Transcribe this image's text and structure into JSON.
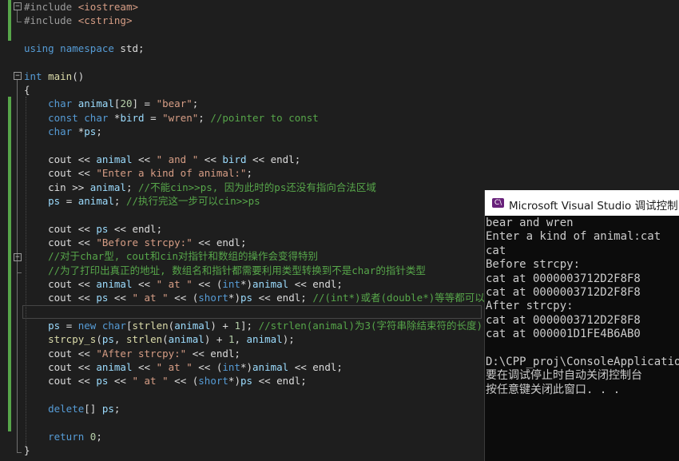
{
  "editor": {
    "lines": [
      [
        [
          "pp",
          "#include "
        ],
        [
          "str",
          "<iostream>"
        ]
      ],
      [
        [
          "pp",
          "#include "
        ],
        [
          "str",
          "<cstring>"
        ]
      ],
      [],
      [
        [
          "kw",
          "using"
        ],
        [
          "pl",
          " "
        ],
        [
          "kw",
          "namespace"
        ],
        [
          "pl",
          " std;"
        ]
      ],
      [],
      [
        [
          "kw",
          "int"
        ],
        [
          "pl",
          " "
        ],
        [
          "fn",
          "main"
        ],
        [
          "pl",
          "()"
        ]
      ],
      [
        [
          "pl",
          "{"
        ]
      ],
      [
        [
          "pl",
          "    "
        ],
        [
          "kw",
          "char"
        ],
        [
          "pl",
          " "
        ],
        [
          "var",
          "animal"
        ],
        [
          "pl",
          "["
        ],
        [
          "num",
          "20"
        ],
        [
          "pl",
          "] = "
        ],
        [
          "str",
          "\"bear\""
        ],
        [
          "pl",
          ";"
        ]
      ],
      [
        [
          "pl",
          "    "
        ],
        [
          "kw",
          "const"
        ],
        [
          "pl",
          " "
        ],
        [
          "kw",
          "char"
        ],
        [
          "pl",
          " *"
        ],
        [
          "var",
          "bird"
        ],
        [
          "pl",
          " = "
        ],
        [
          "str",
          "\"wren\""
        ],
        [
          "pl",
          "; "
        ],
        [
          "cmt",
          "//pointer to const"
        ]
      ],
      [
        [
          "pl",
          "    "
        ],
        [
          "kw",
          "char"
        ],
        [
          "pl",
          " *"
        ],
        [
          "var",
          "ps"
        ],
        [
          "pl",
          ";"
        ]
      ],
      [],
      [
        [
          "pl",
          "    cout << "
        ],
        [
          "var",
          "animal"
        ],
        [
          "pl",
          " << "
        ],
        [
          "str",
          "\" and \""
        ],
        [
          "pl",
          " << "
        ],
        [
          "var",
          "bird"
        ],
        [
          "pl",
          " << endl;"
        ]
      ],
      [
        [
          "pl",
          "    cout << "
        ],
        [
          "str",
          "\"Enter a kind of animal:\""
        ],
        [
          "pl",
          ";"
        ]
      ],
      [
        [
          "pl",
          "    cin >> "
        ],
        [
          "var",
          "animal"
        ],
        [
          "pl",
          "; "
        ],
        [
          "cmt",
          "//不能cin>>ps, 因为此时的ps还没有指向合法区域"
        ]
      ],
      [
        [
          "pl",
          "    "
        ],
        [
          "var",
          "ps"
        ],
        [
          "pl",
          " = "
        ],
        [
          "var",
          "animal"
        ],
        [
          "pl",
          "; "
        ],
        [
          "cmt",
          "//执行完这一步可以cin>>ps"
        ]
      ],
      [],
      [
        [
          "pl",
          "    cout << "
        ],
        [
          "var",
          "ps"
        ],
        [
          "pl",
          " << endl;"
        ]
      ],
      [
        [
          "pl",
          "    cout << "
        ],
        [
          "str",
          "\"Before strcpy:\""
        ],
        [
          "pl",
          " << endl;"
        ]
      ],
      [
        [
          "pl",
          "    "
        ],
        [
          "cmt",
          "//对于char型, cout和cin对指针和数组的操作会变得特别"
        ]
      ],
      [
        [
          "pl",
          "    "
        ],
        [
          "cmt",
          "//为了打印出真正的地址, 数组名和指针都需要利用类型转换到不是char的指针类型"
        ]
      ],
      [
        [
          "pl",
          "    cout << "
        ],
        [
          "var",
          "animal"
        ],
        [
          "pl",
          " << "
        ],
        [
          "str",
          "\" at \""
        ],
        [
          "pl",
          " << ("
        ],
        [
          "kw",
          "int"
        ],
        [
          "pl",
          "*)"
        ],
        [
          "var",
          "animal"
        ],
        [
          "pl",
          " << endl;"
        ]
      ],
      [
        [
          "pl",
          "    cout << "
        ],
        [
          "var",
          "ps"
        ],
        [
          "pl",
          " << "
        ],
        [
          "str",
          "\" at \""
        ],
        [
          "pl",
          " << ("
        ],
        [
          "kw",
          "short"
        ],
        [
          "pl",
          "*)"
        ],
        [
          "var",
          "ps"
        ],
        [
          "pl",
          " << endl; "
        ],
        [
          "cmt",
          "//(int*)或者(double*)等等都可以"
        ]
      ],
      [],
      [
        [
          "pl",
          "    "
        ],
        [
          "var",
          "ps"
        ],
        [
          "pl",
          " = "
        ],
        [
          "kw",
          "new"
        ],
        [
          "pl",
          " "
        ],
        [
          "kw",
          "char"
        ],
        [
          "pl",
          "["
        ],
        [
          "fn",
          "strlen"
        ],
        [
          "pl",
          "("
        ],
        [
          "var",
          "animal"
        ],
        [
          "pl",
          ") + "
        ],
        [
          "num",
          "1"
        ],
        [
          "pl",
          "]; "
        ],
        [
          "cmt",
          "//strlen(animal)为3(字符串除结束符的长度)"
        ]
      ],
      [
        [
          "pl",
          "    "
        ],
        [
          "fn",
          "strcpy_s"
        ],
        [
          "pl",
          "("
        ],
        [
          "var",
          "ps"
        ],
        [
          "pl",
          ", "
        ],
        [
          "fn",
          "strlen"
        ],
        [
          "pl",
          "("
        ],
        [
          "var",
          "animal"
        ],
        [
          "pl",
          ") + "
        ],
        [
          "num",
          "1"
        ],
        [
          "pl",
          ", "
        ],
        [
          "var",
          "animal"
        ],
        [
          "pl",
          ");"
        ]
      ],
      [
        [
          "pl",
          "    cout << "
        ],
        [
          "str",
          "\"After strcpy:\""
        ],
        [
          "pl",
          " << endl;"
        ]
      ],
      [
        [
          "pl",
          "    cout << "
        ],
        [
          "var",
          "animal"
        ],
        [
          "pl",
          " << "
        ],
        [
          "str",
          "\" at \""
        ],
        [
          "pl",
          " << ("
        ],
        [
          "kw",
          "int"
        ],
        [
          "pl",
          "*)"
        ],
        [
          "var",
          "animal"
        ],
        [
          "pl",
          " << endl;"
        ]
      ],
      [
        [
          "pl",
          "    cout << "
        ],
        [
          "var",
          "ps"
        ],
        [
          "pl",
          " << "
        ],
        [
          "str",
          "\" at \""
        ],
        [
          "pl",
          " << ("
        ],
        [
          "kw",
          "short"
        ],
        [
          "pl",
          "*)"
        ],
        [
          "var",
          "ps"
        ],
        [
          "pl",
          " << endl;"
        ]
      ],
      [],
      [
        [
          "pl",
          "    "
        ],
        [
          "kw",
          "delete"
        ],
        [
          "pl",
          "[] "
        ],
        [
          "var",
          "ps"
        ],
        [
          "pl",
          ";"
        ]
      ],
      [],
      [
        [
          "pl",
          "    "
        ],
        [
          "kw",
          "return"
        ],
        [
          "pl",
          " "
        ],
        [
          "num",
          "0"
        ],
        [
          "pl",
          ";"
        ]
      ],
      [
        [
          "pl",
          "}"
        ]
      ]
    ],
    "fold_glyph": "−"
  },
  "console": {
    "icon_label": "C\\",
    "title": "Microsoft Visual Studio 调试控制台",
    "lines": [
      "bear and wren",
      "Enter a kind of animal:cat",
      "cat",
      "Before strcpy:",
      "cat at 0000003712D2F8F8",
      "cat at 0000003712D2F8F8",
      "After strcpy:",
      "cat at 0000003712D2F8F8",
      "cat at 000001D1FE4B6AB0",
      "",
      "D:\\CPP_proj\\ConsoleApplication",
      "要在调试停止时自动关闭控制台",
      "按任意键关闭此窗口. . ."
    ]
  },
  "colors": {
    "editor_bg": "#1e1e1e",
    "keyword": "#569cd6",
    "string": "#d69d85",
    "comment": "#57a64a",
    "variable": "#9cdcfe",
    "function": "#dcdcaa",
    "number": "#b5cea8",
    "console_bg": "#0c0c0c",
    "console_text": "#cccccc"
  }
}
